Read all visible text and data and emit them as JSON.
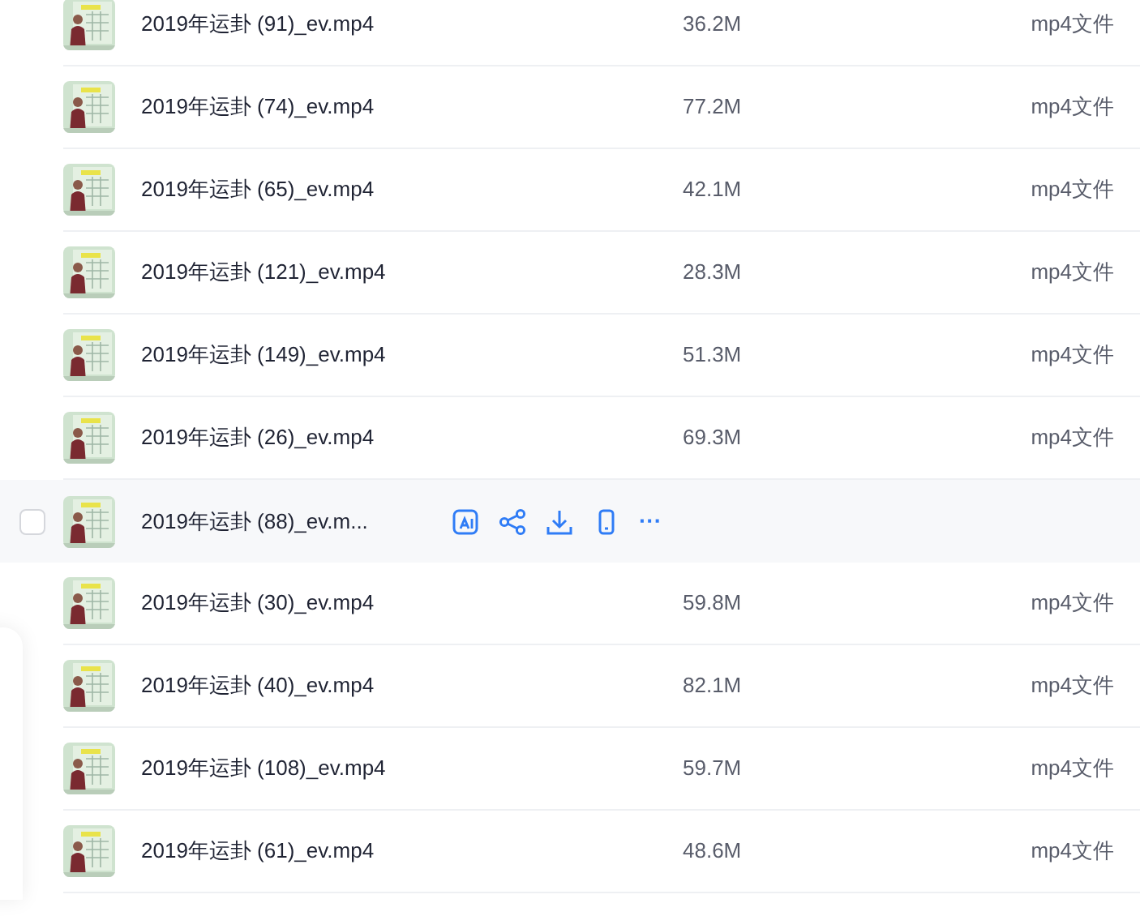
{
  "files": [
    {
      "name": "2019年运卦 (91)_ev.mp4",
      "size": "36.2M",
      "type": "mp4文件",
      "hovered": false
    },
    {
      "name": "2019年运卦 (74)_ev.mp4",
      "size": "77.2M",
      "type": "mp4文件",
      "hovered": false
    },
    {
      "name": "2019年运卦 (65)_ev.mp4",
      "size": "42.1M",
      "type": "mp4文件",
      "hovered": false
    },
    {
      "name": "2019年运卦 (121)_ev.mp4",
      "size": "28.3M",
      "type": "mp4文件",
      "hovered": false
    },
    {
      "name": "2019年运卦 (149)_ev.mp4",
      "size": "51.3M",
      "type": "mp4文件",
      "hovered": false
    },
    {
      "name": "2019年运卦 (26)_ev.mp4",
      "size": "69.3M",
      "type": "mp4文件",
      "hovered": false
    },
    {
      "name": "2019年运卦 (88)_ev.m...",
      "hovered": true,
      "checkbox": {
        "checked": false
      },
      "more": "···"
    },
    {
      "name": "2019年运卦 (30)_ev.mp4",
      "size": "59.8M",
      "type": "mp4文件",
      "hovered": false
    },
    {
      "name": "2019年运卦 (40)_ev.mp4",
      "size": "82.1M",
      "type": "mp4文件",
      "hovered": false
    },
    {
      "name": "2019年运卦 (108)_ev.mp4",
      "size": "59.7M",
      "type": "mp4文件",
      "hovered": false
    },
    {
      "name": "2019年运卦 (61)_ev.mp4",
      "size": "48.6M",
      "type": "mp4文件",
      "hovered": false
    }
  ]
}
